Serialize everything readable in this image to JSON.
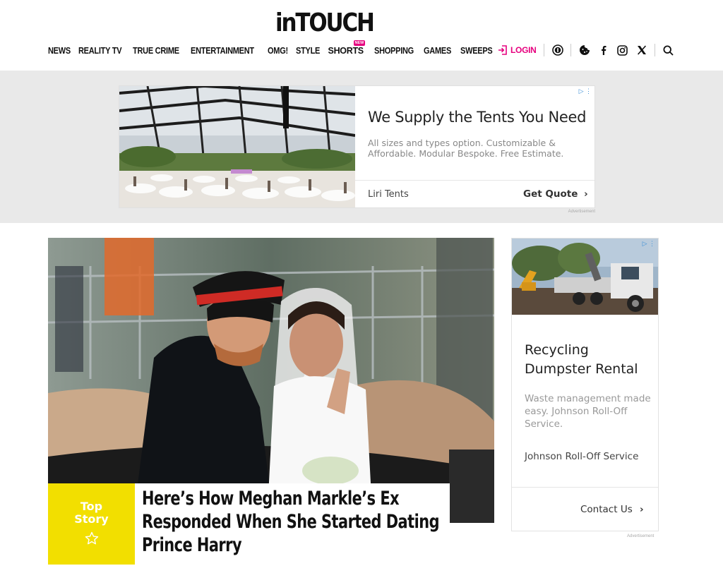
{
  "brand": {
    "logo_text": "inTOUCH",
    "accent_color": "#e6007e",
    "top_story_color": "#f2df00"
  },
  "nav": {
    "items": [
      {
        "label": "NEWS"
      },
      {
        "label": "REALITY TV"
      },
      {
        "label": "TRUE CRIME"
      },
      {
        "label": "ENTERTAINMENT"
      },
      {
        "label": "OMG!"
      },
      {
        "label": "STYLE"
      },
      {
        "label": "SHORTS",
        "badge": "NEW"
      },
      {
        "label": "SHOPPING"
      },
      {
        "label": "GAMES"
      },
      {
        "label": "SWEEPS"
      }
    ]
  },
  "tools": {
    "login_label": "LOGIN",
    "icons": [
      "accessibility-icon",
      "cookie-icon",
      "facebook-icon",
      "instagram-icon",
      "x-icon",
      "search-icon"
    ]
  },
  "banner_ad": {
    "title": "We Supply the Tents You Need",
    "description": "All sizes and types option. Customizable & Affordable. Modular Bespoke. Free Estimate.",
    "advertiser": "Liri Tents",
    "cta": "Get Quote",
    "label": "Advertisement"
  },
  "hero": {
    "badge_line1": "Top",
    "badge_line2": "Story",
    "headline": "Here’s How Meghan Markle’s Ex Responded When She Started Dating Prince Harry"
  },
  "side_ad": {
    "title": "Recycling Dumpster Rental",
    "description": "Waste management made easy. Johnson Roll-Off Service.",
    "advertiser": "Johnson Roll-Off Service",
    "cta": "Contact Us",
    "label": "Advertisement"
  }
}
